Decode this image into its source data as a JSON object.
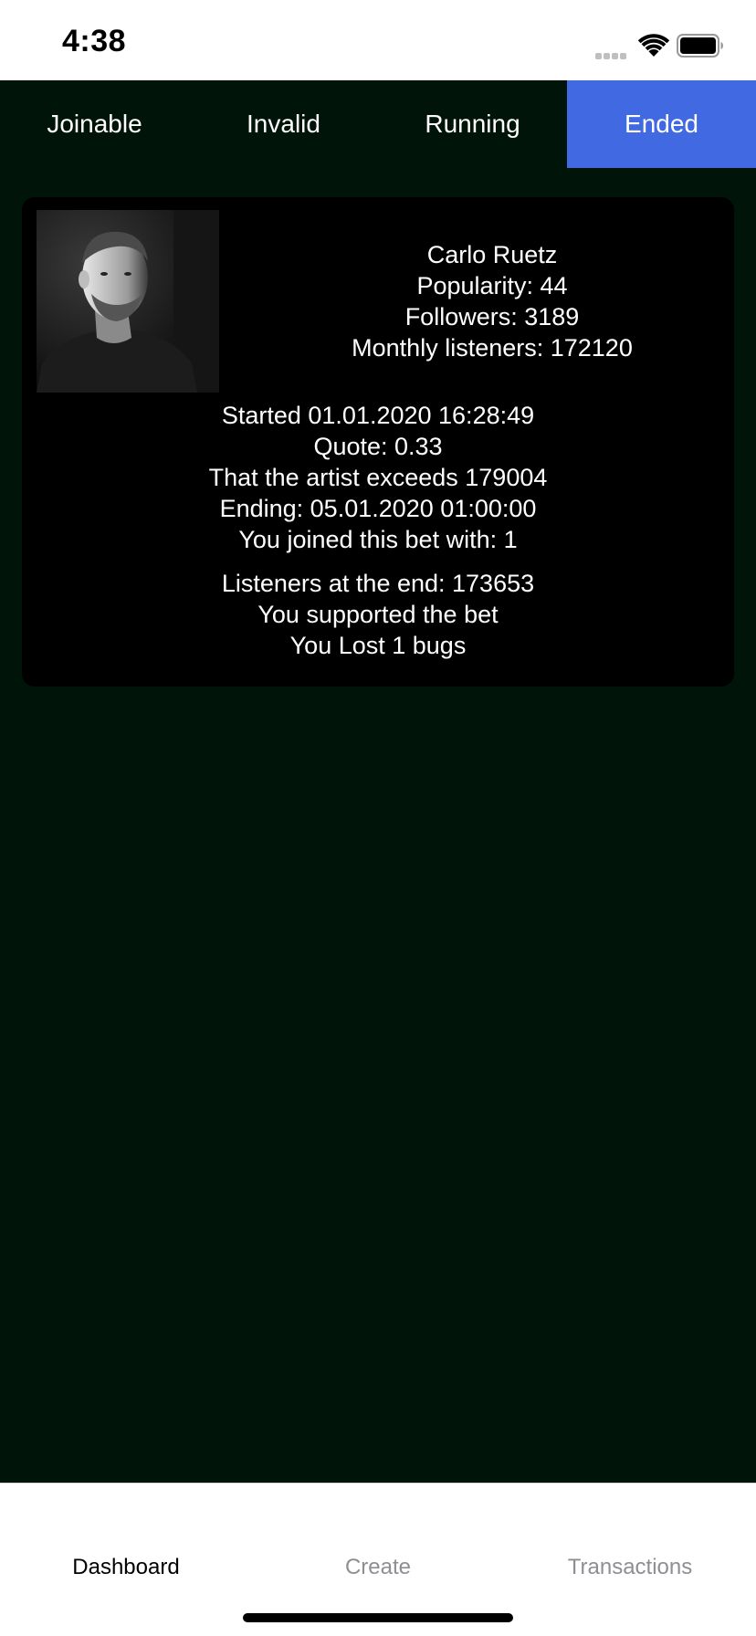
{
  "status_bar": {
    "time": "4:38"
  },
  "tabs": [
    {
      "label": "Joinable",
      "active": false
    },
    {
      "label": "Invalid",
      "active": false
    },
    {
      "label": "Running",
      "active": false
    },
    {
      "label": "Ended",
      "active": true
    }
  ],
  "bet": {
    "artist_name": "Carlo Ruetz",
    "popularity": "Popularity: 44",
    "followers": "Followers: 3189",
    "monthly_listeners": "Monthly listeners: 172120",
    "started": "Started 01.01.2020 16:28:49",
    "quote": "Quote: 0.33",
    "condition": "That the artist exceeds 179004",
    "ending": "Ending: 05.01.2020 01:00:00",
    "joined_with": "You joined this bet with: 1",
    "listeners_end": "Listeners at the end: 173653",
    "support": "You supported the bet",
    "outcome": "You Lost 1 bugs"
  },
  "bottom_nav": [
    {
      "label": "Dashboard",
      "active": true
    },
    {
      "label": "Create",
      "active": false
    },
    {
      "label": "Transactions",
      "active": false
    }
  ],
  "colors": {
    "background": "#001409",
    "card": "#000000",
    "tab_active": "#4169e1"
  }
}
